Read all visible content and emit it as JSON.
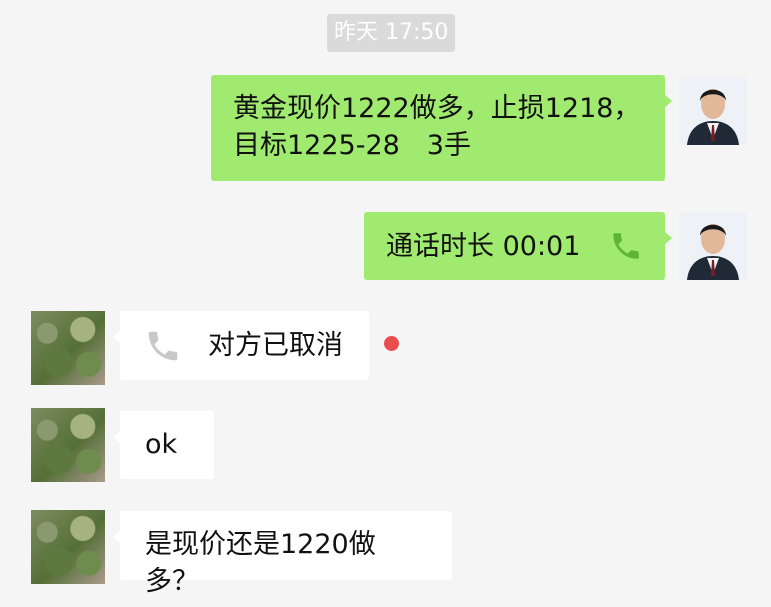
{
  "timestamp": "昨天 17:50",
  "messages": [
    {
      "side": "self",
      "text": "黄金现价1222做多，止损1218，目标1225-28　3手"
    },
    {
      "side": "self",
      "type": "call",
      "text": "通话时长 00:01",
      "icon": "phone-icon"
    },
    {
      "side": "peer",
      "type": "call",
      "text": "对方已取消",
      "icon": "phone-icon",
      "unread": true
    },
    {
      "side": "peer",
      "text": "ok"
    },
    {
      "side": "peer",
      "text": "是现价还是1220做多？"
    }
  ],
  "colors": {
    "background": "#f5f5f5",
    "self_bubble": "#a0ea6f",
    "peer_bubble": "#ffffff",
    "unread_dot": "#ea4d4d",
    "timestamp_bg": "#dadada"
  }
}
